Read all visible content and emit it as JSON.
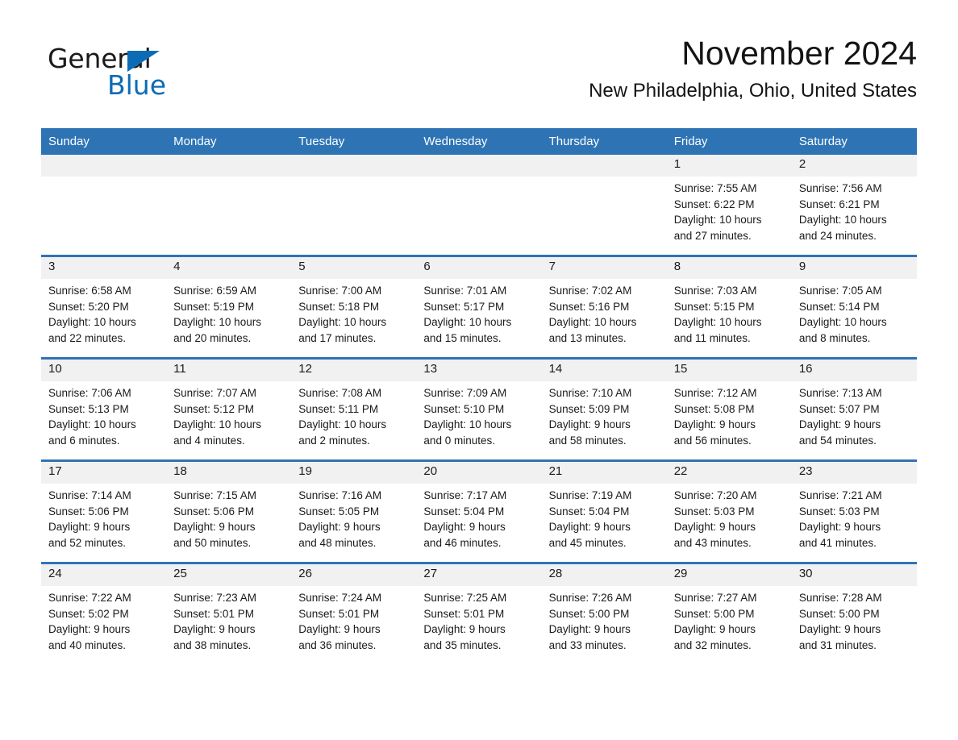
{
  "brand": {
    "name_part1": "General",
    "name_part2": "Blue",
    "accent_color": "#0b6cb5"
  },
  "header": {
    "month_title": "November 2024",
    "location": "New Philadelphia, Ohio, United States",
    "header_bg_color": "#2e74b5",
    "daynum_bg_color": "#f1f1f1"
  },
  "calendar": {
    "weekday_headers": [
      "Sunday",
      "Monday",
      "Tuesday",
      "Wednesday",
      "Thursday",
      "Friday",
      "Saturday"
    ],
    "weeks": [
      [
        {
          "day": "",
          "sunrise": "",
          "sunset": "",
          "daylight_line1": "",
          "daylight_line2": ""
        },
        {
          "day": "",
          "sunrise": "",
          "sunset": "",
          "daylight_line1": "",
          "daylight_line2": ""
        },
        {
          "day": "",
          "sunrise": "",
          "sunset": "",
          "daylight_line1": "",
          "daylight_line2": ""
        },
        {
          "day": "",
          "sunrise": "",
          "sunset": "",
          "daylight_line1": "",
          "daylight_line2": ""
        },
        {
          "day": "",
          "sunrise": "",
          "sunset": "",
          "daylight_line1": "",
          "daylight_line2": ""
        },
        {
          "day": "1",
          "sunrise": "Sunrise: 7:55 AM",
          "sunset": "Sunset: 6:22 PM",
          "daylight_line1": "Daylight: 10 hours",
          "daylight_line2": "and 27 minutes."
        },
        {
          "day": "2",
          "sunrise": "Sunrise: 7:56 AM",
          "sunset": "Sunset: 6:21 PM",
          "daylight_line1": "Daylight: 10 hours",
          "daylight_line2": "and 24 minutes."
        }
      ],
      [
        {
          "day": "3",
          "sunrise": "Sunrise: 6:58 AM",
          "sunset": "Sunset: 5:20 PM",
          "daylight_line1": "Daylight: 10 hours",
          "daylight_line2": "and 22 minutes."
        },
        {
          "day": "4",
          "sunrise": "Sunrise: 6:59 AM",
          "sunset": "Sunset: 5:19 PM",
          "daylight_line1": "Daylight: 10 hours",
          "daylight_line2": "and 20 minutes."
        },
        {
          "day": "5",
          "sunrise": "Sunrise: 7:00 AM",
          "sunset": "Sunset: 5:18 PM",
          "daylight_line1": "Daylight: 10 hours",
          "daylight_line2": "and 17 minutes."
        },
        {
          "day": "6",
          "sunrise": "Sunrise: 7:01 AM",
          "sunset": "Sunset: 5:17 PM",
          "daylight_line1": "Daylight: 10 hours",
          "daylight_line2": "and 15 minutes."
        },
        {
          "day": "7",
          "sunrise": "Sunrise: 7:02 AM",
          "sunset": "Sunset: 5:16 PM",
          "daylight_line1": "Daylight: 10 hours",
          "daylight_line2": "and 13 minutes."
        },
        {
          "day": "8",
          "sunrise": "Sunrise: 7:03 AM",
          "sunset": "Sunset: 5:15 PM",
          "daylight_line1": "Daylight: 10 hours",
          "daylight_line2": "and 11 minutes."
        },
        {
          "day": "9",
          "sunrise": "Sunrise: 7:05 AM",
          "sunset": "Sunset: 5:14 PM",
          "daylight_line1": "Daylight: 10 hours",
          "daylight_line2": "and 8 minutes."
        }
      ],
      [
        {
          "day": "10",
          "sunrise": "Sunrise: 7:06 AM",
          "sunset": "Sunset: 5:13 PM",
          "daylight_line1": "Daylight: 10 hours",
          "daylight_line2": "and 6 minutes."
        },
        {
          "day": "11",
          "sunrise": "Sunrise: 7:07 AM",
          "sunset": "Sunset: 5:12 PM",
          "daylight_line1": "Daylight: 10 hours",
          "daylight_line2": "and 4 minutes."
        },
        {
          "day": "12",
          "sunrise": "Sunrise: 7:08 AM",
          "sunset": "Sunset: 5:11 PM",
          "daylight_line1": "Daylight: 10 hours",
          "daylight_line2": "and 2 minutes."
        },
        {
          "day": "13",
          "sunrise": "Sunrise: 7:09 AM",
          "sunset": "Sunset: 5:10 PM",
          "daylight_line1": "Daylight: 10 hours",
          "daylight_line2": "and 0 minutes."
        },
        {
          "day": "14",
          "sunrise": "Sunrise: 7:10 AM",
          "sunset": "Sunset: 5:09 PM",
          "daylight_line1": "Daylight: 9 hours",
          "daylight_line2": "and 58 minutes."
        },
        {
          "day": "15",
          "sunrise": "Sunrise: 7:12 AM",
          "sunset": "Sunset: 5:08 PM",
          "daylight_line1": "Daylight: 9 hours",
          "daylight_line2": "and 56 minutes."
        },
        {
          "day": "16",
          "sunrise": "Sunrise: 7:13 AM",
          "sunset": "Sunset: 5:07 PM",
          "daylight_line1": "Daylight: 9 hours",
          "daylight_line2": "and 54 minutes."
        }
      ],
      [
        {
          "day": "17",
          "sunrise": "Sunrise: 7:14 AM",
          "sunset": "Sunset: 5:06 PM",
          "daylight_line1": "Daylight: 9 hours",
          "daylight_line2": "and 52 minutes."
        },
        {
          "day": "18",
          "sunrise": "Sunrise: 7:15 AM",
          "sunset": "Sunset: 5:06 PM",
          "daylight_line1": "Daylight: 9 hours",
          "daylight_line2": "and 50 minutes."
        },
        {
          "day": "19",
          "sunrise": "Sunrise: 7:16 AM",
          "sunset": "Sunset: 5:05 PM",
          "daylight_line1": "Daylight: 9 hours",
          "daylight_line2": "and 48 minutes."
        },
        {
          "day": "20",
          "sunrise": "Sunrise: 7:17 AM",
          "sunset": "Sunset: 5:04 PM",
          "daylight_line1": "Daylight: 9 hours",
          "daylight_line2": "and 46 minutes."
        },
        {
          "day": "21",
          "sunrise": "Sunrise: 7:19 AM",
          "sunset": "Sunset: 5:04 PM",
          "daylight_line1": "Daylight: 9 hours",
          "daylight_line2": "and 45 minutes."
        },
        {
          "day": "22",
          "sunrise": "Sunrise: 7:20 AM",
          "sunset": "Sunset: 5:03 PM",
          "daylight_line1": "Daylight: 9 hours",
          "daylight_line2": "and 43 minutes."
        },
        {
          "day": "23",
          "sunrise": "Sunrise: 7:21 AM",
          "sunset": "Sunset: 5:03 PM",
          "daylight_line1": "Daylight: 9 hours",
          "daylight_line2": "and 41 minutes."
        }
      ],
      [
        {
          "day": "24",
          "sunrise": "Sunrise: 7:22 AM",
          "sunset": "Sunset: 5:02 PM",
          "daylight_line1": "Daylight: 9 hours",
          "daylight_line2": "and 40 minutes."
        },
        {
          "day": "25",
          "sunrise": "Sunrise: 7:23 AM",
          "sunset": "Sunset: 5:01 PM",
          "daylight_line1": "Daylight: 9 hours",
          "daylight_line2": "and 38 minutes."
        },
        {
          "day": "26",
          "sunrise": "Sunrise: 7:24 AM",
          "sunset": "Sunset: 5:01 PM",
          "daylight_line1": "Daylight: 9 hours",
          "daylight_line2": "and 36 minutes."
        },
        {
          "day": "27",
          "sunrise": "Sunrise: 7:25 AM",
          "sunset": "Sunset: 5:01 PM",
          "daylight_line1": "Daylight: 9 hours",
          "daylight_line2": "and 35 minutes."
        },
        {
          "day": "28",
          "sunrise": "Sunrise: 7:26 AM",
          "sunset": "Sunset: 5:00 PM",
          "daylight_line1": "Daylight: 9 hours",
          "daylight_line2": "and 33 minutes."
        },
        {
          "day": "29",
          "sunrise": "Sunrise: 7:27 AM",
          "sunset": "Sunset: 5:00 PM",
          "daylight_line1": "Daylight: 9 hours",
          "daylight_line2": "and 32 minutes."
        },
        {
          "day": "30",
          "sunrise": "Sunrise: 7:28 AM",
          "sunset": "Sunset: 5:00 PM",
          "daylight_line1": "Daylight: 9 hours",
          "daylight_line2": "and 31 minutes."
        }
      ]
    ]
  }
}
